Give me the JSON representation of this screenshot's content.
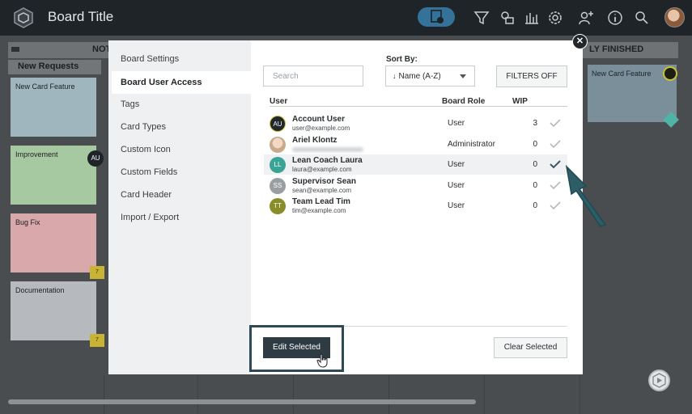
{
  "app": {
    "board_title": "Board Title"
  },
  "topbar": {
    "icons": [
      "board-view-icon",
      "filter-icon",
      "card-types-icon",
      "analytics-icon",
      "settings-icon",
      "add-user-icon",
      "info-icon",
      "search-icon",
      "user-avatar"
    ]
  },
  "board": {
    "lane_left": "NOT",
    "lane_right": "LY FINISHED",
    "column_header": "New Requests",
    "cards": [
      {
        "title": "New Card Feature",
        "color": "#9fb6bf"
      },
      {
        "title": "Improvement",
        "color": "#a6c9a2",
        "badge": "AU"
      },
      {
        "title": "Bug Fix",
        "color": "#d8a8ab",
        "cal": "7"
      },
      {
        "title": "Documentation",
        "color": "#b6babe",
        "cal": "7"
      }
    ],
    "right_card": "New Card Feature"
  },
  "modal": {
    "side_items": [
      "Board Settings",
      "Board User Access",
      "Tags",
      "Card Types",
      "Custom Icon",
      "Custom Fields",
      "Card Header",
      "Import / Export"
    ],
    "active_item": "Board User Access",
    "search_placeholder": "Search",
    "sort_label": "Sort By:",
    "sort_value": "Name (A-Z)",
    "filters_label": "FILTERS OFF",
    "headers": {
      "user": "User",
      "role": "Board Role",
      "wip": "WIP"
    },
    "users": [
      {
        "name": "Account User",
        "email": "user@example.com",
        "role": "User",
        "wip": "3",
        "initials": "AU",
        "avatar_color": "#22272b",
        "selected": false
      },
      {
        "name": "Ariel Klontz",
        "email": "",
        "role": "Administrator",
        "wip": "0",
        "initials": "",
        "avatar_color": "#d9b8a0",
        "selected": false
      },
      {
        "name": "Lean Coach Laura",
        "email": "laura@example.com",
        "role": "User",
        "wip": "0",
        "initials": "LL",
        "avatar_color": "#3aa395",
        "selected": true
      },
      {
        "name": "Supervisor Sean",
        "email": "sean@example.com",
        "role": "User",
        "wip": "0",
        "initials": "SS",
        "avatar_color": "#9b9ea1",
        "selected": false
      },
      {
        "name": "Team Lead Tim",
        "email": "tim@example.com",
        "role": "User",
        "wip": "0",
        "initials": "TT",
        "avatar_color": "#8a8c27",
        "selected": false
      }
    ],
    "edit_selected": "Edit Selected",
    "clear_selected": "Clear Selected"
  }
}
